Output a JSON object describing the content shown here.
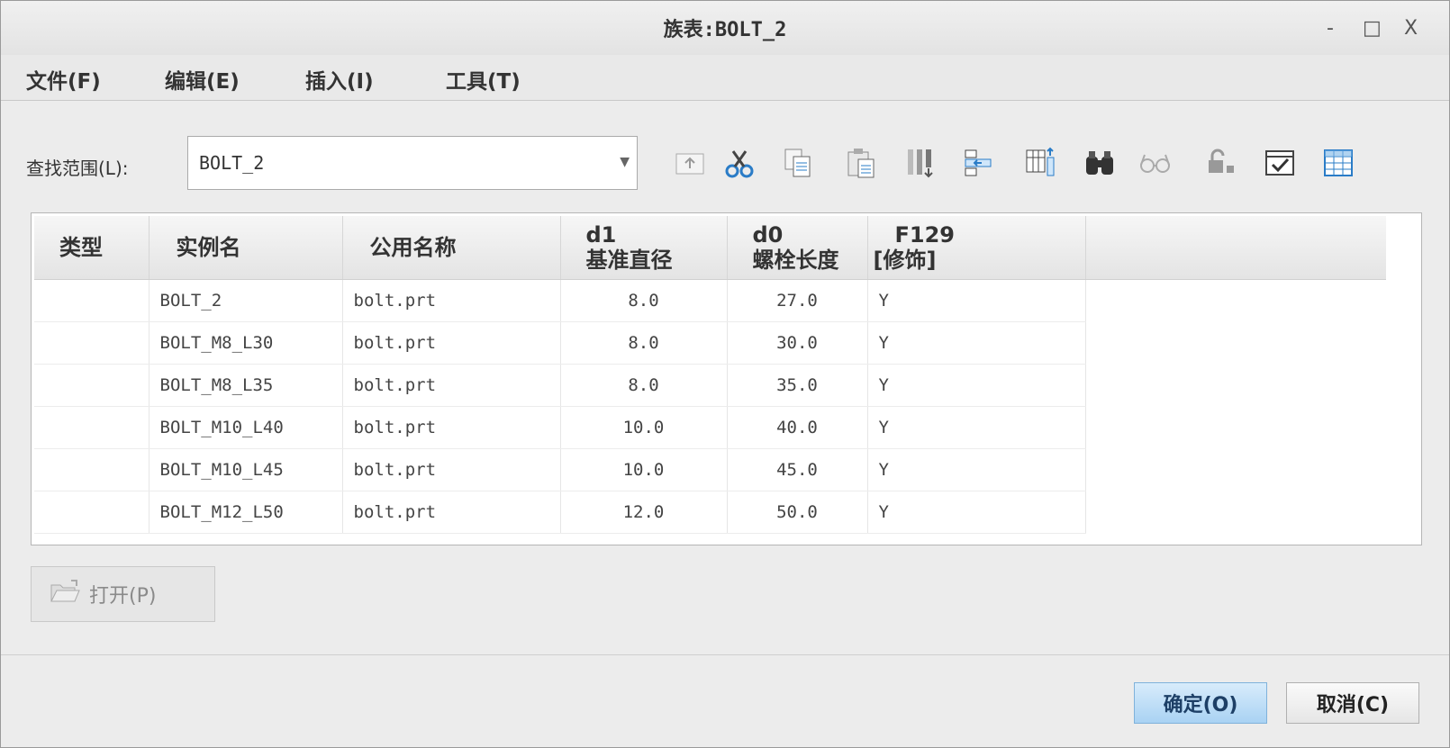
{
  "window": {
    "title": "族表:BOLT_2",
    "controls": [
      "-",
      "□",
      "X"
    ]
  },
  "menu": [
    {
      "label": "文件(F)"
    },
    {
      "label": "编辑(E)"
    },
    {
      "label": "插入(I)"
    },
    {
      "label": "工具(T)"
    }
  ],
  "search": {
    "label": "查找范围(L):",
    "value": "BOLT_2"
  },
  "toolbar": {
    "icons": [
      "folder-up-icon",
      "cut-icon",
      "copy-icon",
      "paste-icon",
      "insert-rows-icon",
      "insert-column-icon",
      "add-column-icon",
      "find-icon",
      "preview-icon",
      "lock-icon",
      "verify-icon",
      "table-icon"
    ]
  },
  "table": {
    "columns": [
      {
        "line1": "类型",
        "line2": ""
      },
      {
        "line1": "实例名",
        "line2": ""
      },
      {
        "line1": "公用名称",
        "line2": ""
      },
      {
        "line1": "d1",
        "line2": "基准直径"
      },
      {
        "line1": "d0",
        "line2": "螺栓长度"
      },
      {
        "line1": "F129",
        "line2": "[修饰]"
      }
    ],
    "rows": [
      {
        "type": "",
        "instance": "BOLT_2",
        "common": "bolt.prt",
        "d1": "8.0",
        "d0": "27.0",
        "f129": "Y"
      },
      {
        "type": "",
        "instance": "BOLT_M8_L30",
        "common": "bolt.prt",
        "d1": "8.0",
        "d0": "30.0",
        "f129": "Y"
      },
      {
        "type": "",
        "instance": "BOLT_M8_L35",
        "common": "bolt.prt",
        "d1": "8.0",
        "d0": "35.0",
        "f129": "Y"
      },
      {
        "type": "",
        "instance": "BOLT_M10_L40",
        "common": "bolt.prt",
        "d1": "10.0",
        "d0": "40.0",
        "f129": "Y"
      },
      {
        "type": "",
        "instance": "BOLT_M10_L45",
        "common": "bolt.prt",
        "d1": "10.0",
        "d0": "45.0",
        "f129": "Y"
      },
      {
        "type": "",
        "instance": "BOLT_M12_L50",
        "common": "bolt.prt",
        "d1": "12.0",
        "d0": "50.0",
        "f129": "Y"
      }
    ]
  },
  "buttons": {
    "open": "打开(P)",
    "ok": "确定(O)",
    "cancel": "取消(C)"
  },
  "colors": {
    "ok_bg": "#a9d2f3",
    "window_bg": "#ececec",
    "icon_blue": "#2a7cc7"
  }
}
